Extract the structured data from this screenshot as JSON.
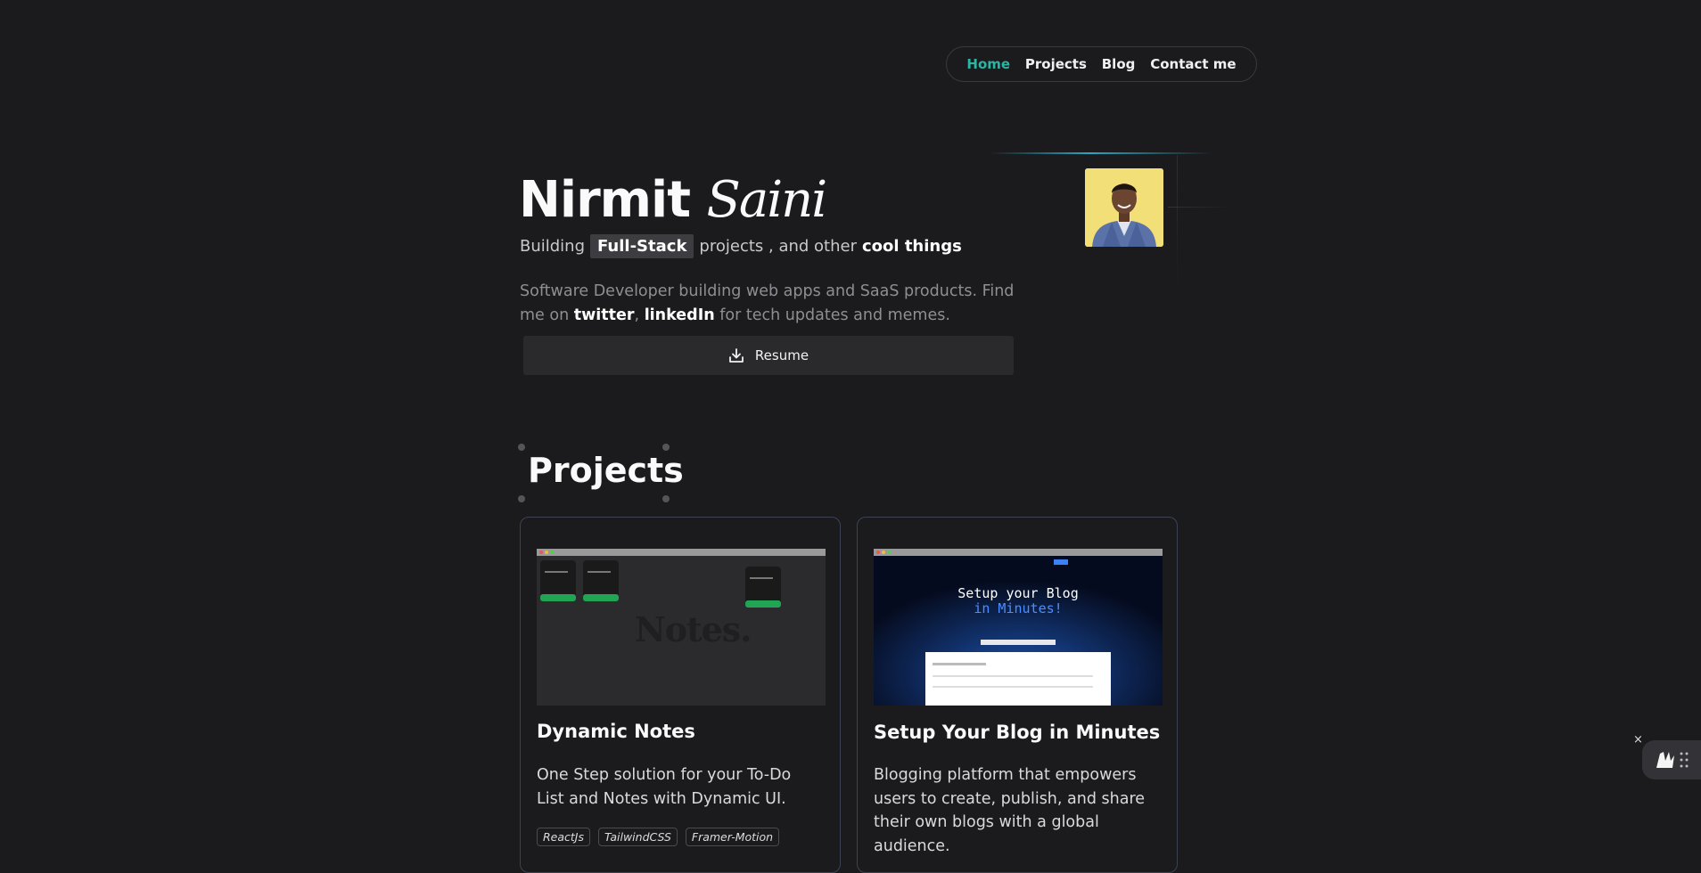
{
  "nav": {
    "items": [
      {
        "label": "Home",
        "active": true
      },
      {
        "label": "Projects",
        "active": false
      },
      {
        "label": "Blog",
        "active": false
      },
      {
        "label": "Contact me",
        "active": false
      }
    ],
    "active_color": "#2bb5a3"
  },
  "hero": {
    "first_name": "Nirmit",
    "last_name": "Saini",
    "tagline_prefix": "Building",
    "tagline_chip": "Full-Stack",
    "tagline_middle": "projects , and other",
    "tagline_bold": "cool things",
    "bio_prefix": "Software Developer building web apps and SaaS products. Find me on",
    "bio_link_twitter": "twitter",
    "bio_sep": ",",
    "bio_link_linkedin": "linkedIn",
    "bio_suffix": "for tech updates and memes.",
    "resume_label": "Resume",
    "resume_icon": "download-icon",
    "avatar_icon": "profile-photo"
  },
  "projects": {
    "heading": "Projects",
    "cards": [
      {
        "title": "Dynamic Notes",
        "description": "One Step solution for your To-Do List and Notes with Dynamic UI.",
        "tags": [
          "ReactJs",
          "TailwindCSS",
          "Framer-Motion"
        ],
        "preview": {
          "watermark": "Notes."
        }
      },
      {
        "title": "Setup Your Blog in Minutes",
        "description": "Blogging platform that empowers users to create, publish, and share their own blogs with a global audience.",
        "tags": [],
        "preview": {
          "headline_1": "Setup your Blog",
          "headline_2": "in Minutes!"
        }
      }
    ]
  },
  "widget": {
    "close_label": "×",
    "icon": "accessibility-widget-icon"
  },
  "colors": {
    "background": "#1b1b1d",
    "accent": "#2bb5a3",
    "card_border": "#3a4254"
  }
}
